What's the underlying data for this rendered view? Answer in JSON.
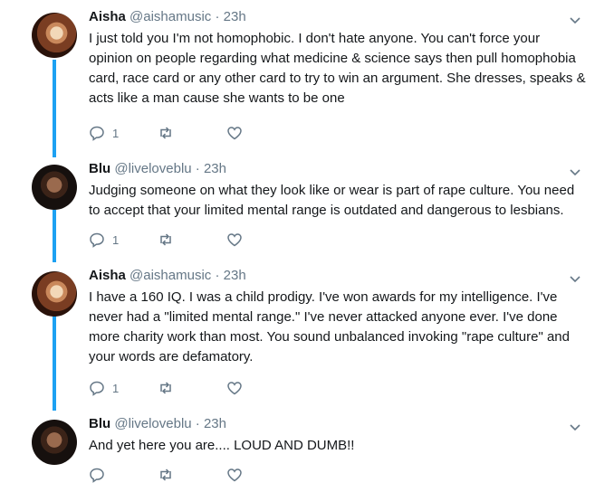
{
  "tweets": [
    {
      "name": "Aisha",
      "handle": "@aishamusic",
      "time": "· 23h",
      "text": "I just told you I'm not homophobic. I don't hate anyone. You can't force your opinion on people regarding what medicine & science says then pull homophobia card, race card or any other card to try to win an argument. She dresses, speaks & acts like a man cause she wants to be one",
      "reply_count": "1",
      "retweet_count": "",
      "like_count": ""
    },
    {
      "name": "Blu",
      "handle": "@liveloveblu",
      "time": "· 23h",
      "text": "Judging someone on what they look like or wear is part of rape culture. You need to accept that your limited mental range is outdated and dangerous to lesbians.",
      "reply_count": "1",
      "retweet_count": "",
      "like_count": ""
    },
    {
      "name": "Aisha",
      "handle": "@aishamusic",
      "time": "· 23h",
      "text": "I have a 160 IQ. I was a child prodigy. I've won awards for my intelligence. I've never had a \"limited mental range.\" I've never attacked anyone ever. I've done more charity work than most. You sound unbalanced invoking \"rape culture\" and your words are defamatory.",
      "reply_count": "1",
      "retweet_count": "",
      "like_count": ""
    },
    {
      "name": "Blu",
      "handle": "@liveloveblu",
      "time": "· 23h",
      "text": "And yet here you are.... LOUD AND DUMB!!",
      "reply_count": "",
      "retweet_count": "",
      "like_count": ""
    }
  ],
  "icons": {
    "reply": "reply-icon",
    "retweet": "retweet-icon",
    "like": "heart-icon",
    "caret": "chevron-down-icon"
  },
  "colors": {
    "thread_line": "#1da1f2",
    "secondary_text": "#657786",
    "primary_text": "#14171a"
  }
}
